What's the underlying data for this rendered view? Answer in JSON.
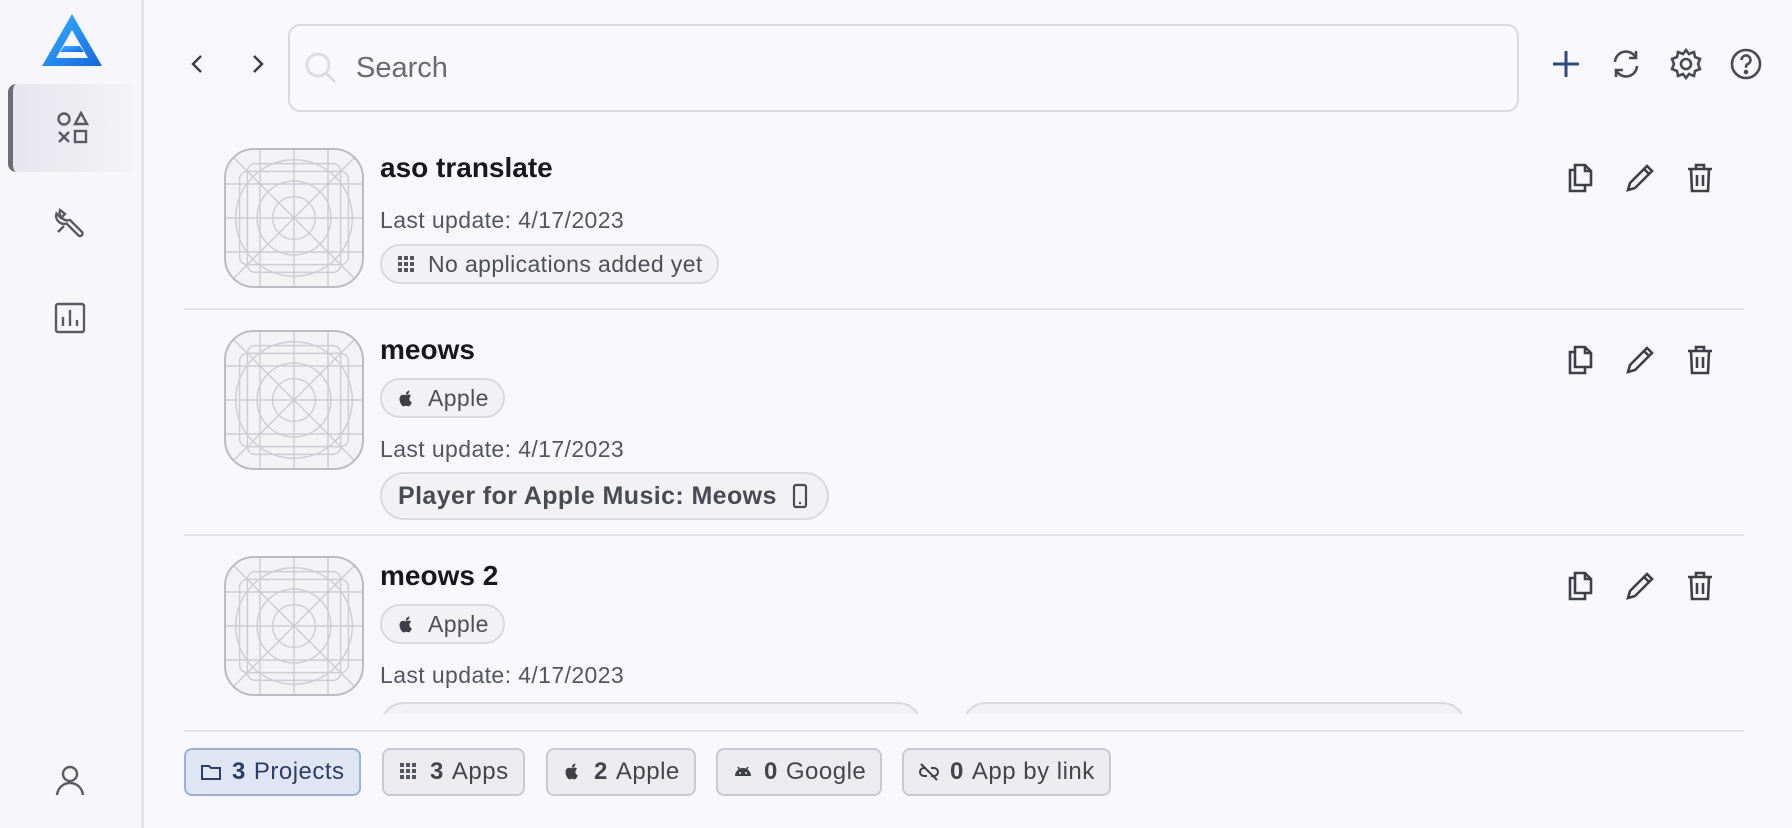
{
  "search": {
    "placeholder": "Search"
  },
  "sidebar": {
    "items": [
      {
        "name": "apps",
        "active": true
      },
      {
        "name": "tools",
        "active": false
      },
      {
        "name": "analytics",
        "active": false
      }
    ]
  },
  "projects": [
    {
      "name": "aso translate",
      "last_update": "Last update: 4/17/2023",
      "apps_chip": "No applications added yet"
    },
    {
      "name": "meows",
      "platform": "Apple",
      "last_update": "Last update: 4/17/2023",
      "app_chip": "Player for Apple Music: Meows"
    },
    {
      "name": "meows 2",
      "platform": "Apple",
      "last_update": "Last update: 4/17/2023"
    }
  ],
  "footer": {
    "projects": {
      "count": "3",
      "label": "Projects"
    },
    "apps": {
      "count": "3",
      "label": "Apps"
    },
    "apple": {
      "count": "2",
      "label": "Apple"
    },
    "google": {
      "count": "0",
      "label": "Google"
    },
    "by_link": {
      "count": "0",
      "label": "App by link"
    }
  },
  "colors": {
    "accent": "#1e88f0",
    "active_filter_bg": "#dfe5f2",
    "add_icon": "#2c4a80"
  },
  "icons": [
    "app-logo",
    "apps-icon",
    "tools-icon",
    "chart-icon",
    "user-icon",
    "chevron-left-icon",
    "chevron-right-icon",
    "search-icon",
    "plus-icon",
    "refresh-icon",
    "gear-icon",
    "help-icon",
    "copy-icon",
    "edit-icon",
    "trash-icon",
    "apple-icon",
    "grid-icon",
    "phone-icon",
    "folder-icon",
    "android-icon",
    "link-off-icon"
  ]
}
